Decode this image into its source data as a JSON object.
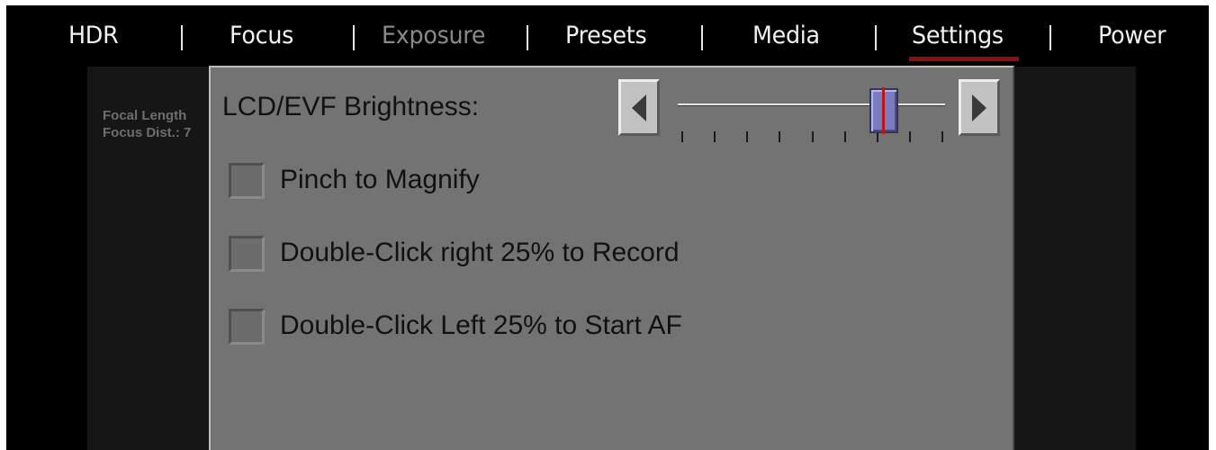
{
  "menu": {
    "tabs": [
      {
        "label": "HDR",
        "state": "enabled"
      },
      {
        "label": "Focus",
        "state": "enabled"
      },
      {
        "label": "Exposure",
        "state": "disabled"
      },
      {
        "label": "Presets",
        "state": "enabled"
      },
      {
        "label": "Media",
        "state": "enabled"
      },
      {
        "label": "Settings",
        "state": "selected"
      },
      {
        "label": "Power",
        "state": "enabled"
      }
    ],
    "selected_tab": "Settings",
    "separator": "|",
    "underline_color": "#8b1010"
  },
  "background_view": {
    "focal_length": "Focal Length",
    "focus_dist": "Focus Dist.: 7"
  },
  "settings": {
    "brightness": {
      "label": "LCD/EVF Brightness:",
      "tick_count": 9,
      "value_fraction": 0.78,
      "left_arrow_icon": "triangle-left-icon",
      "right_arrow_icon": "triangle-right-icon"
    },
    "options": [
      {
        "label": "Pinch to Magnify",
        "checked": false
      },
      {
        "label": "Double-Click right 25% to Record",
        "checked": false
      },
      {
        "label": "Double-Click Left 25% to Start AF",
        "checked": false
      }
    ]
  },
  "colors": {
    "panel_bg": "#737373",
    "slider_thumb": "#7b7bc0",
    "slider_indicator": "#c01414",
    "disabled_text": "#8a8a8a"
  }
}
